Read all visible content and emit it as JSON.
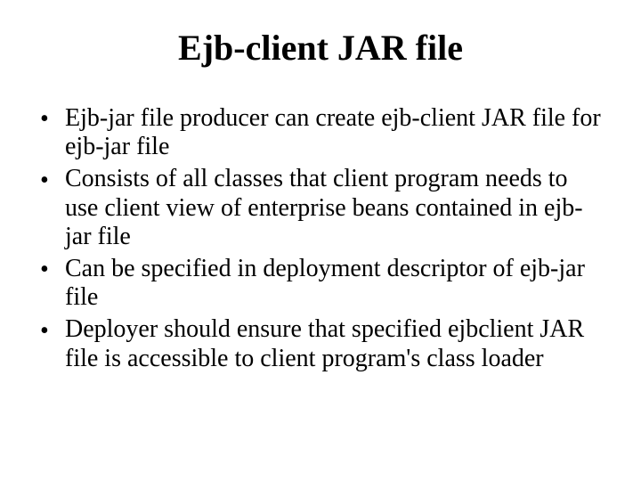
{
  "title": "Ejb-client JAR file",
  "bullets": [
    "Ejb-jar file producer can create ejb-client JAR file for ejb-jar file",
    "Consists of all classes that client program needs to use client view of enterprise beans contained in ejb-jar file",
    "Can be specified in deployment descriptor of ejb-jar file",
    "Deployer should ensure that specified ejbclient JAR file is accessible to client program's class loader"
  ]
}
